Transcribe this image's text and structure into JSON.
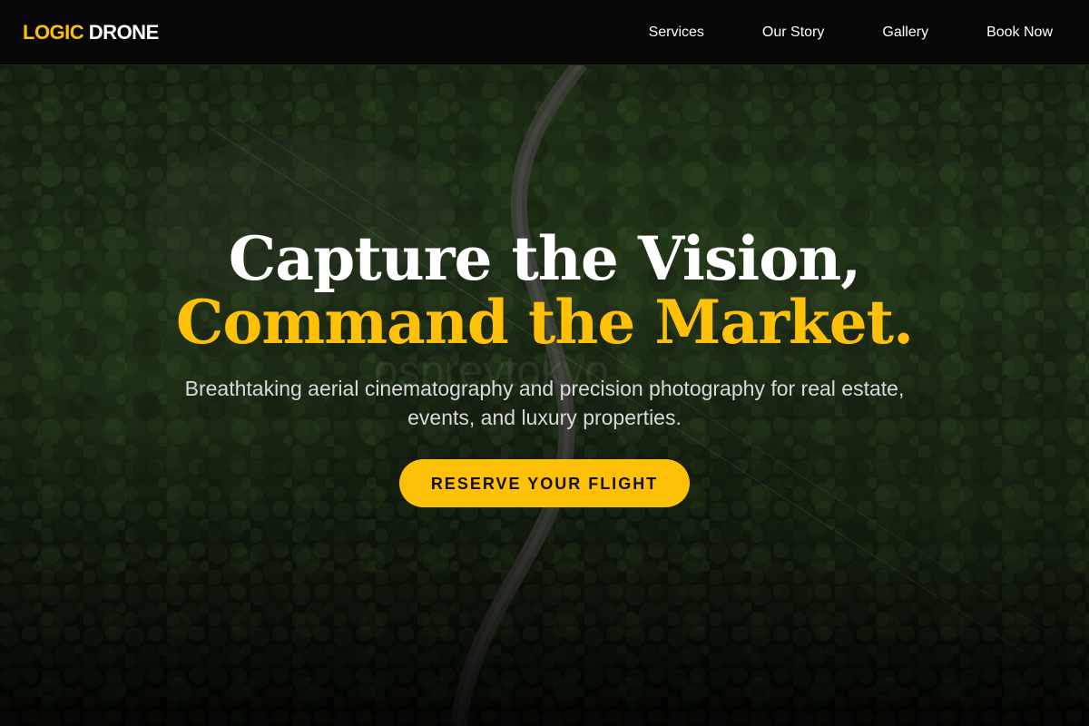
{
  "header": {
    "logo_accent": "LOGIC",
    "logo_main": "DRONE",
    "nav": [
      {
        "label": "Services"
      },
      {
        "label": "Our Story"
      },
      {
        "label": "Gallery"
      },
      {
        "label": "Book Now"
      }
    ]
  },
  "hero": {
    "headline_line1": "Capture the Vision,",
    "headline_line2": "Command the Market.",
    "subtext": "Breathtaking aerial cinematography and precision photography for real estate, events, and luxury properties.",
    "cta_label": "RESERVE YOUR FLIGHT",
    "watermark": "ospreytokyo",
    "background": "aerial-forest-road-photo"
  },
  "colors": {
    "accent": "#ffc107",
    "header_bg": "#050505",
    "text_primary": "#ffffff",
    "text_secondary": "#d9d9d9"
  }
}
